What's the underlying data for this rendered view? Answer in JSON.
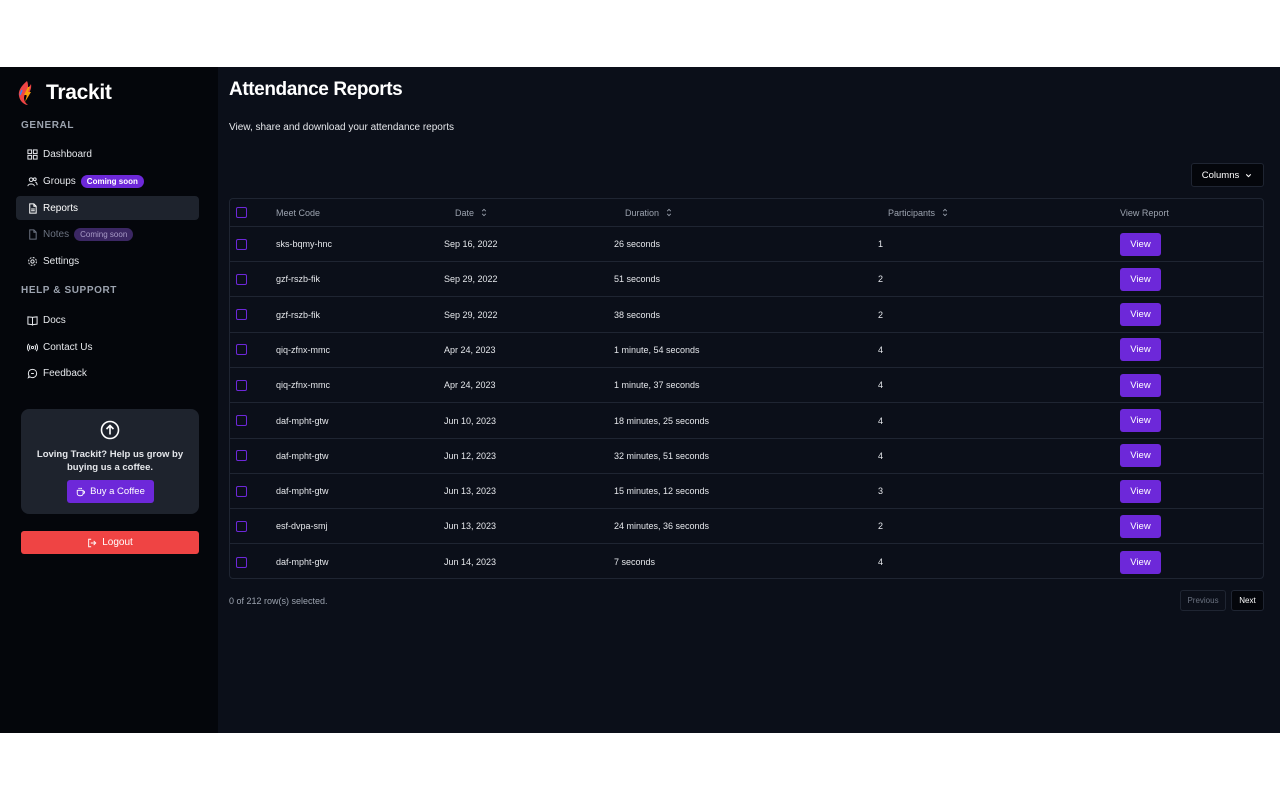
{
  "brand": {
    "name": "Trackit"
  },
  "sidebar": {
    "general_label": "GENERAL",
    "help_label": "HELP & SUPPORT",
    "items": [
      {
        "label": "Dashboard",
        "icon": "grid-icon"
      },
      {
        "label": "Groups",
        "icon": "users-icon",
        "badge": "Coming soon"
      },
      {
        "label": "Reports",
        "icon": "file-icon",
        "active": true
      },
      {
        "label": "Notes",
        "icon": "note-icon",
        "badge": "Coming soon",
        "disabled": true
      },
      {
        "label": "Settings",
        "icon": "gear-icon"
      }
    ],
    "help_items": [
      {
        "label": "Docs",
        "icon": "book-icon"
      },
      {
        "label": "Contact Us",
        "icon": "broadcast-icon"
      },
      {
        "label": "Feedback",
        "icon": "message-icon"
      }
    ],
    "coffee_card": {
      "text": "Loving Trackit? Help us grow by buying us a coffee.",
      "button_label": "Buy a Coffee"
    },
    "logout_label": "Logout"
  },
  "main": {
    "title": "Attendance Reports",
    "subtitle": "View, share and download your attendance reports",
    "columns_button": "Columns",
    "table": {
      "headers": {
        "meet_code": "Meet Code",
        "date": "Date",
        "duration": "Duration",
        "participants": "Participants",
        "view_report": "View Report"
      },
      "view_label": "View",
      "rows": [
        {
          "code": "sks-bqmy-hnc",
          "date": "Sep 16, 2022",
          "duration": "26 seconds",
          "participants": "1"
        },
        {
          "code": "gzf-rszb-fik",
          "date": "Sep 29, 2022",
          "duration": "51 seconds",
          "participants": "2"
        },
        {
          "code": "gzf-rszb-fik",
          "date": "Sep 29, 2022",
          "duration": "38 seconds",
          "participants": "2"
        },
        {
          "code": "qiq-zfnx-mmc",
          "date": "Apr 24, 2023",
          "duration": "1 minute, 54 seconds",
          "participants": "4"
        },
        {
          "code": "qiq-zfnx-mmc",
          "date": "Apr 24, 2023",
          "duration": "1 minute, 37 seconds",
          "participants": "4"
        },
        {
          "code": "daf-mpht-gtw",
          "date": "Jun 10, 2023",
          "duration": "18 minutes, 25 seconds",
          "participants": "4"
        },
        {
          "code": "daf-mpht-gtw",
          "date": "Jun 12, 2023",
          "duration": "32 minutes, 51 seconds",
          "participants": "4"
        },
        {
          "code": "daf-mpht-gtw",
          "date": "Jun 13, 2023",
          "duration": "15 minutes, 12 seconds",
          "participants": "3"
        },
        {
          "code": "esf-dvpa-smj",
          "date": "Jun 13, 2023",
          "duration": "24 minutes, 36 seconds",
          "participants": "2"
        },
        {
          "code": "daf-mpht-gtw",
          "date": "Jun 14, 2023",
          "duration": "7 seconds",
          "participants": "4"
        }
      ]
    },
    "footer": {
      "selection_status": "0 of 212 row(s) selected.",
      "previous_label": "Previous",
      "next_label": "Next"
    }
  },
  "colors": {
    "accent": "#6d28d9",
    "danger": "#ef4444",
    "sidebar_bg": "#04060b",
    "main_bg": "#0b0f19"
  }
}
